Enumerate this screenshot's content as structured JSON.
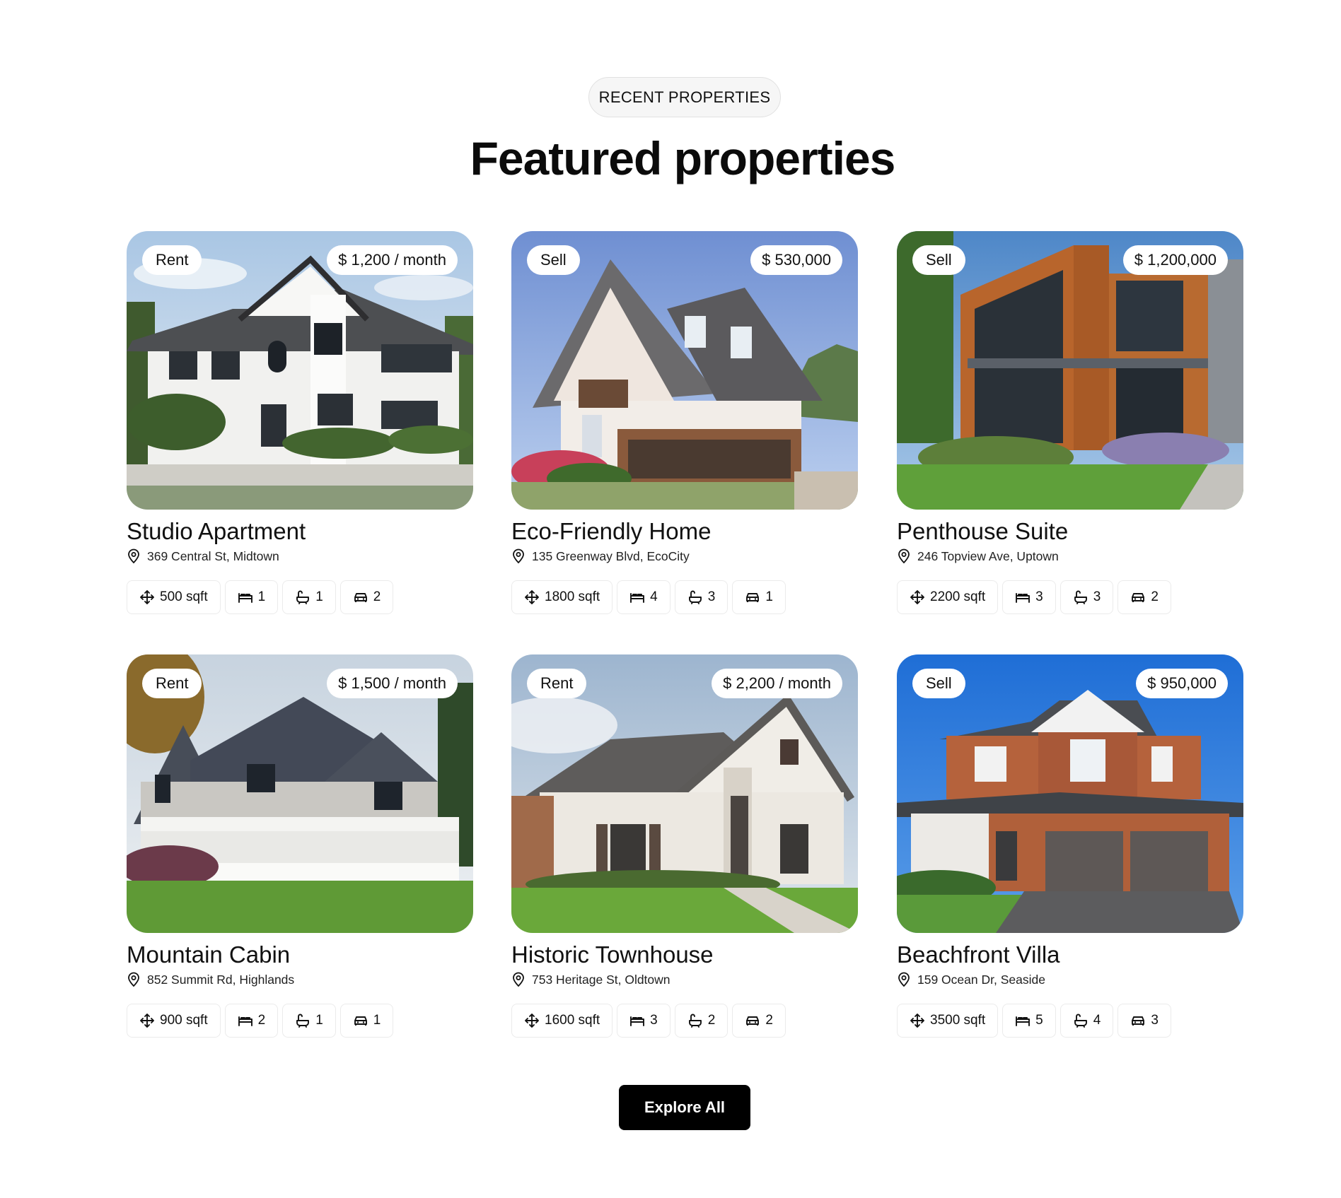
{
  "section": {
    "eyebrow": "RECENT PROPERTIES",
    "title": "Featured properties"
  },
  "properties": [
    {
      "status": "Rent",
      "price": "$ 1,200 / month",
      "title": "Studio Apartment",
      "address": "369 Central St, Midtown",
      "area": "500 sqft",
      "beds": "1",
      "baths": "1",
      "garage": "2"
    },
    {
      "status": "Sell",
      "price": "$ 530,000",
      "title": "Eco-Friendly Home",
      "address": "135 Greenway Blvd, EcoCity",
      "area": "1800 sqft",
      "beds": "4",
      "baths": "3",
      "garage": "1"
    },
    {
      "status": "Sell",
      "price": "$ 1,200,000",
      "title": "Penthouse Suite",
      "address": "246 Topview Ave, Uptown",
      "area": "2200 sqft",
      "beds": "3",
      "baths": "3",
      "garage": "2"
    },
    {
      "status": "Rent",
      "price": "$ 1,500 / month",
      "title": "Mountain Cabin",
      "address": "852 Summit Rd, Highlands",
      "area": "900 sqft",
      "beds": "2",
      "baths": "1",
      "garage": "1"
    },
    {
      "status": "Rent",
      "price": "$ 2,200 / month",
      "title": "Historic Townhouse",
      "address": "753 Heritage St, Oldtown",
      "area": "1600 sqft",
      "beds": "3",
      "baths": "2",
      "garage": "2"
    },
    {
      "status": "Sell",
      "price": "$ 950,000",
      "title": "Beachfront Villa",
      "address": "159 Ocean Dr, Seaside",
      "area": "3500 sqft",
      "beds": "5",
      "baths": "4",
      "garage": "3"
    }
  ],
  "cta": {
    "label": "Explore All"
  },
  "icons": {
    "location": "map-pin-icon",
    "area": "move-arrows-icon",
    "beds": "bed-icon",
    "baths": "bathtub-icon",
    "garage": "car-icon"
  },
  "colors": {
    "button_bg": "#000000",
    "button_text": "#ffffff",
    "pill_bg": "#ffffff",
    "spec_border": "#ebebeb"
  }
}
